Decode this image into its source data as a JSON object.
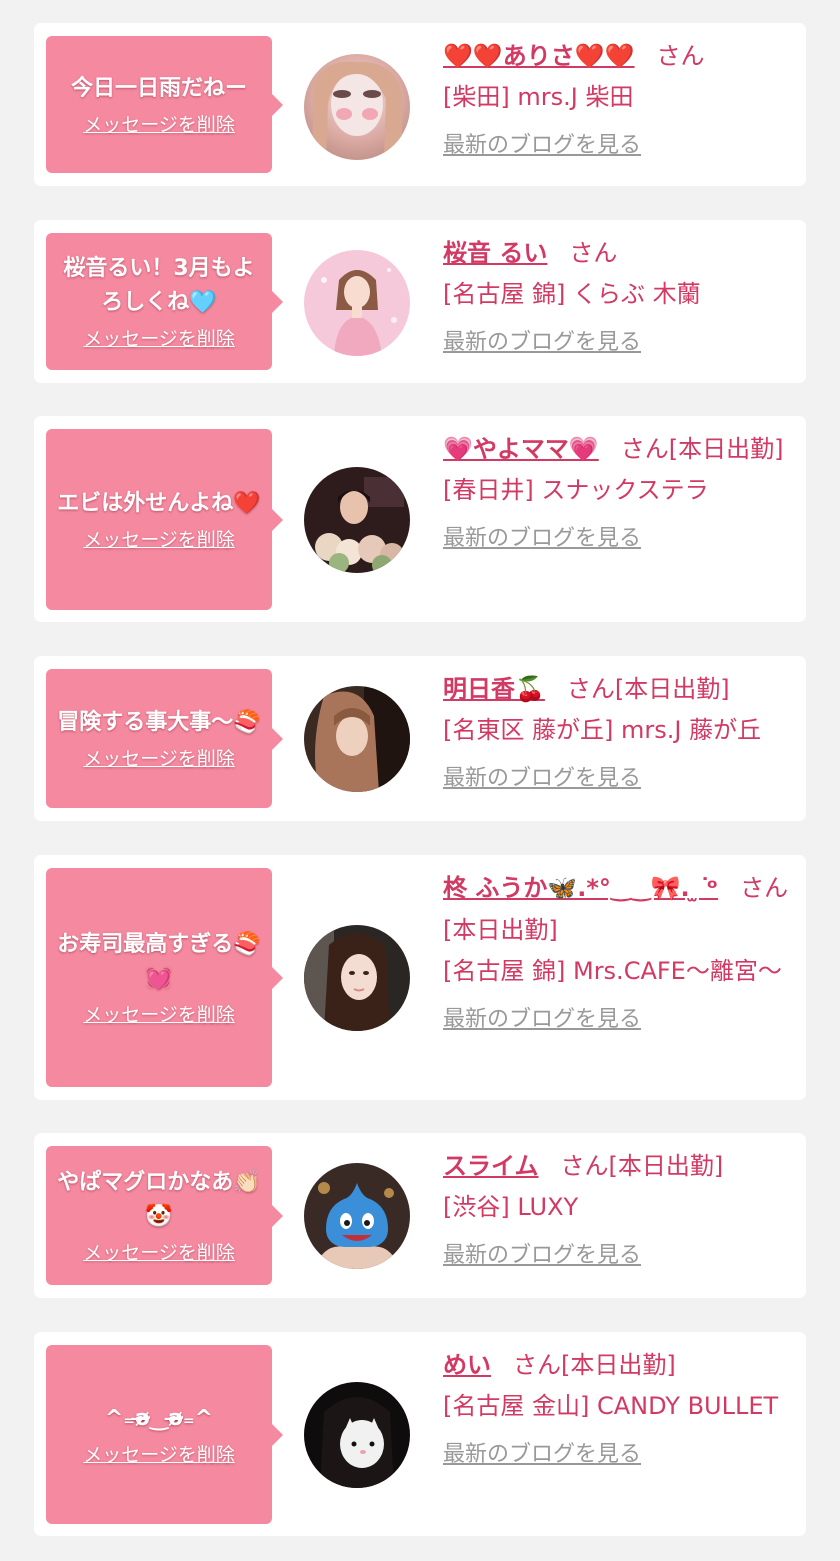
{
  "delete_label": "メッセージを削除",
  "blog_label": "最新のブログを見る",
  "san_label": "さん",
  "colors": {
    "bubble": "#f4899f",
    "accent": "#d23a64",
    "link_gray": "#999999",
    "background": "#f2f2f3"
  },
  "cards": [
    {
      "message": "今日一日雨だねー",
      "name": "❤️❤️ありさ❤️❤️",
      "status": "",
      "shop": "[柴田] mrs.J 柴田"
    },
    {
      "message": "桜音るい！3月もよろしくね🩵",
      "name": "桜音 るい",
      "status": "",
      "shop": "[名古屋 錦] くらぶ 木蘭"
    },
    {
      "message": "エビは外せんよね❤️",
      "name": "💗やよママ💗",
      "status": "[本日出勤]",
      "shop": "[春日井] スナックステラ"
    },
    {
      "message": "冒険する事大事〜🍣",
      "name": "明日香🍒",
      "status": "[本日出勤]",
      "shop": "[名東区 藤が丘] mrs.J 藤が丘"
    },
    {
      "message": "お寿司最高すぎる🍣💓",
      "name": "柊 ふうか🦋.*°‿‿🎀. ̫ ͘ᵒ",
      "status": "[本日出勤]",
      "shop": "[名古屋 錦] Mrs.CAFE〜離宮〜"
    },
    {
      "message": "やぱマグロかなあ👏🏻🤡",
      "name": "スライム",
      "status": "[本日出勤]",
      "shop": "[渋谷] LUXY"
    },
    {
      "message": "^₌ә̴̶̷‿ә̴̶̷₌^",
      "name": "めい",
      "status": "[本日出勤]",
      "shop": "[名古屋 金山] CANDY BULLET"
    }
  ]
}
